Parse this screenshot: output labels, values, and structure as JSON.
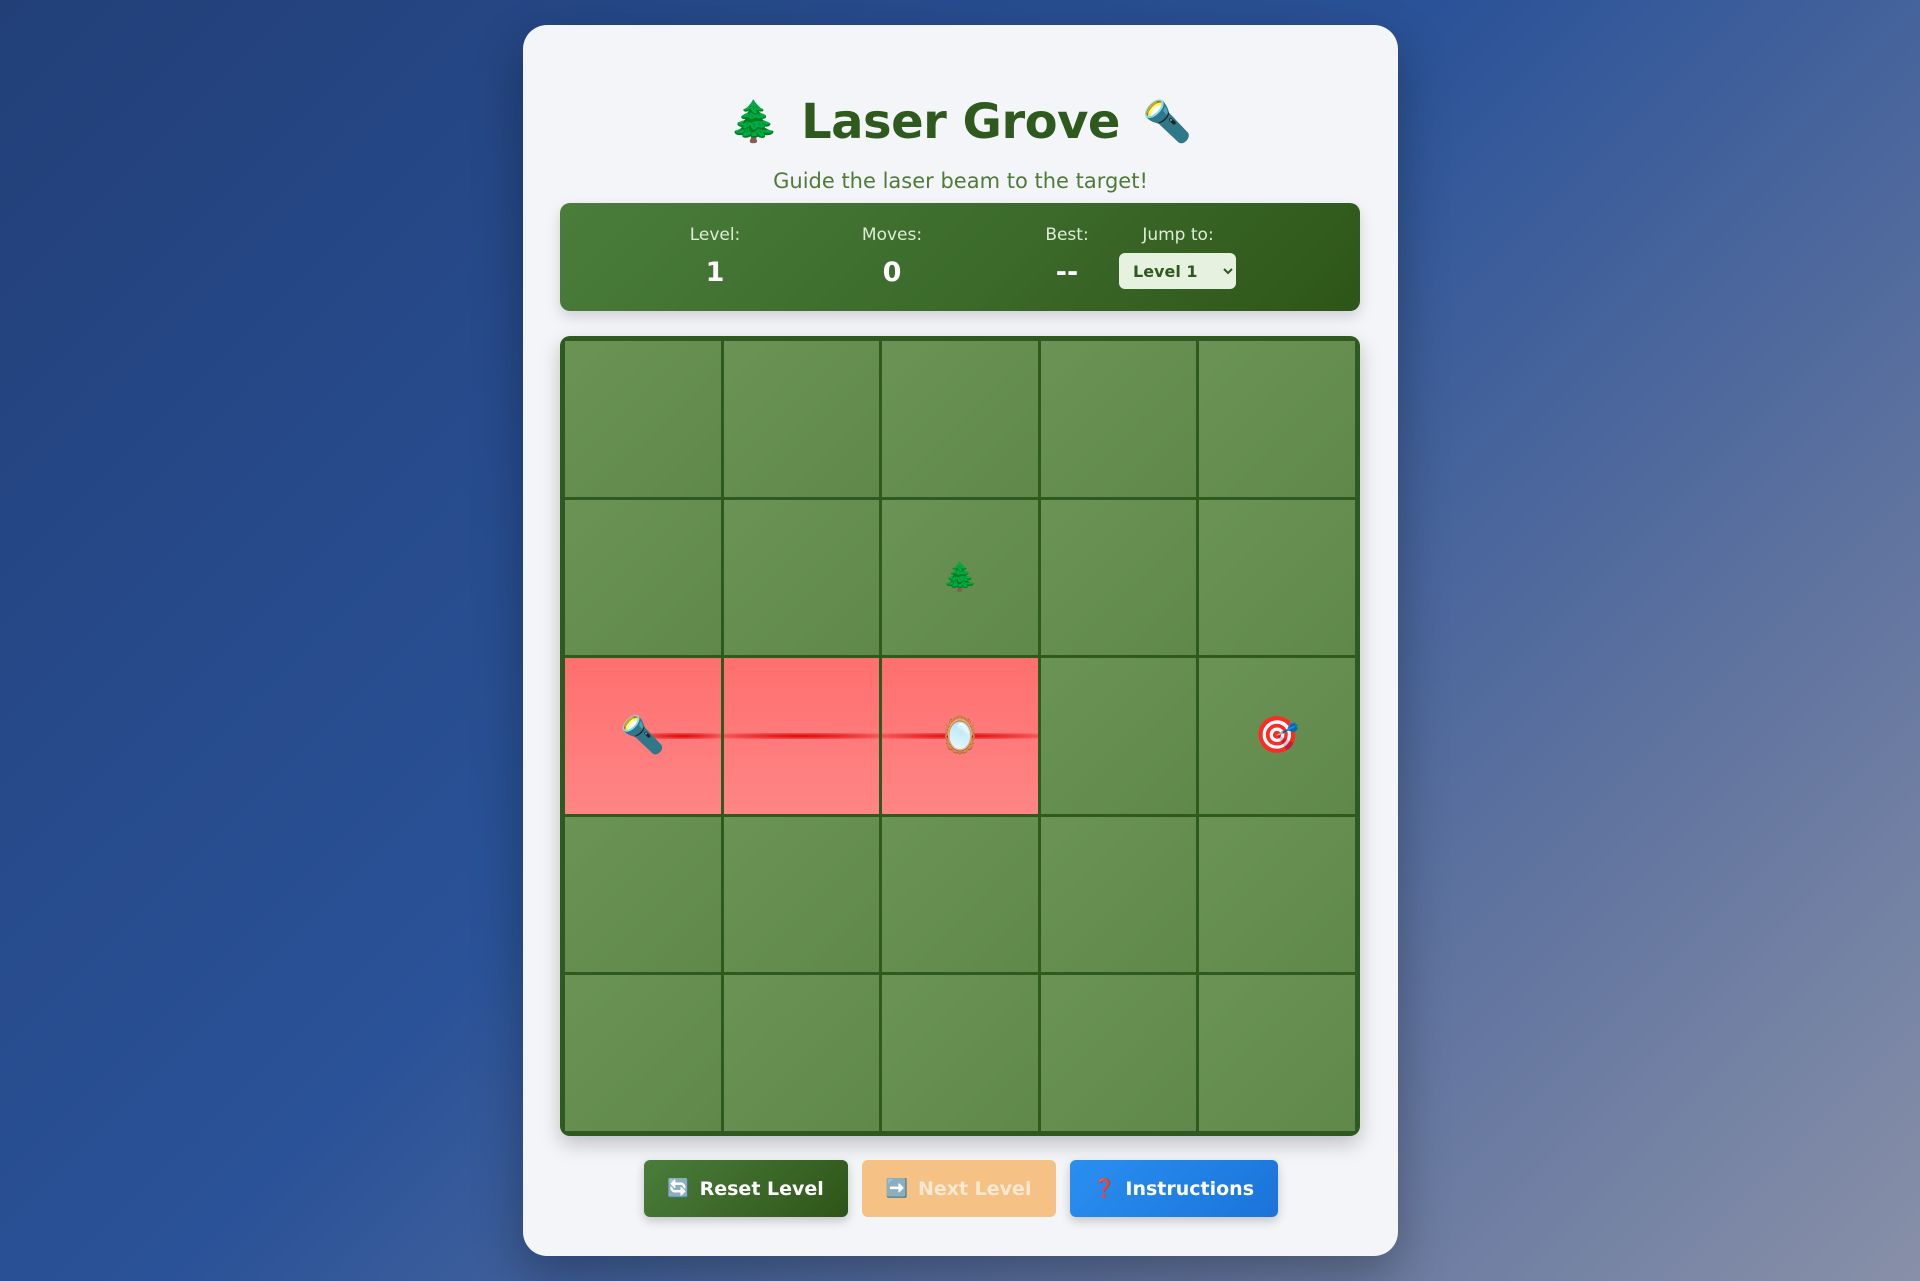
{
  "header": {
    "title": "Laser Grove",
    "title_icon_left": "🌲",
    "title_icon_right": "🔦",
    "subtitle": "Guide the laser beam to the target!"
  },
  "stats": {
    "level_label": "Level:",
    "level_value": "1",
    "moves_label": "Moves:",
    "moves_value": "0",
    "best_label": "Best:",
    "best_value": "--",
    "jump_label": "Jump to:",
    "jump_selected": "Level 1"
  },
  "board": {
    "rows": 5,
    "cols": 5,
    "cells": [
      [
        "",
        "",
        "",
        "",
        ""
      ],
      [
        "",
        "",
        "tree",
        "",
        ""
      ],
      [
        "laser",
        "beam",
        "mirror",
        "",
        "target"
      ],
      [
        "",
        "",
        "",
        "",
        ""
      ],
      [
        "",
        "",
        "",
        "",
        ""
      ]
    ],
    "lit": [
      [
        0,
        0,
        0,
        0,
        0
      ],
      [
        0,
        0,
        0,
        0,
        0
      ],
      [
        1,
        1,
        1,
        0,
        0
      ],
      [
        0,
        0,
        0,
        0,
        0
      ],
      [
        0,
        0,
        0,
        0,
        0
      ]
    ],
    "glyphs": {
      "tree": "🌲",
      "laser": "🔦",
      "mirror": "🪞",
      "target": "🎯"
    }
  },
  "buttons": {
    "reset_icon": "🔄",
    "reset_label": "Reset Level",
    "next_icon": "➡️",
    "next_label": "Next Level",
    "help_icon": "❓",
    "help_label": "Instructions"
  },
  "colors": {
    "beam_cell": "#ff7a7a",
    "grass_cell": "#66904f",
    "title": "#2e5a1e",
    "accent_blue": "#2a8ff0"
  }
}
